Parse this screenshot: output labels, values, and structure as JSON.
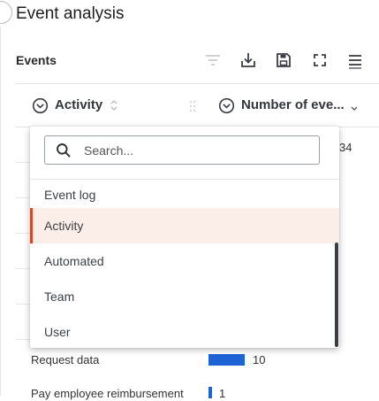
{
  "page": {
    "title": "Event analysis"
  },
  "card": {
    "title": "Events",
    "toolbar": [
      {
        "name": "filter-icon",
        "label": "Filter"
      },
      {
        "name": "download-icon",
        "label": "Download"
      },
      {
        "name": "save-icon",
        "label": "Save"
      },
      {
        "name": "fullscreen-icon",
        "label": "Full screen"
      },
      {
        "name": "menu-icon",
        "label": "Menu"
      }
    ]
  },
  "table": {
    "columns": [
      {
        "label": "Activity",
        "icon": "chevron-circle-icon",
        "sort_icon": "sort-icon"
      },
      {
        "label": "Number of eve...",
        "icon": "chevron-circle-icon",
        "sort_icon": "sort-desc-icon"
      }
    ],
    "rows": [
      {
        "activity": "",
        "value": "34"
      },
      {
        "activity": "Request data",
        "value": "10",
        "fraction": 0.294
      },
      {
        "activity": "Pay employee reimbursement",
        "value": "1",
        "fraction": 0.029
      }
    ]
  },
  "dropdown": {
    "search_placeholder": "Search...",
    "group_label": "Event log",
    "options": [
      "Activity",
      "Automated",
      "Team",
      "User"
    ],
    "selected": "Activity"
  },
  "colors": {
    "bar": "#1e63d6",
    "selected_marker": "#d24a28",
    "selected_bg": "#fbeee8"
  }
}
